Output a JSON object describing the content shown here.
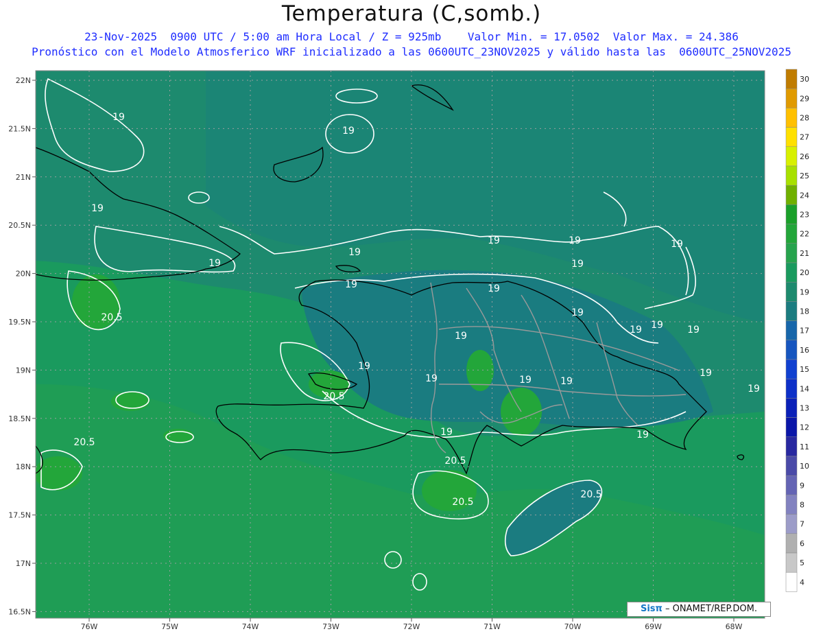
{
  "header": {
    "title": "Temperatura (C,somb.)",
    "line1": "23-Nov-2025  0900 UTC / 5:00 am Hora Local / Z = 925mb    Valor Min. = 17.0502  Valor Max. = 24.386",
    "line2": "Pronóstico con el Modelo Atmosferico WRF inicializado a las 0600UTC_23NOV2025 y válido hasta las  0600UTC_25NOV2025"
  },
  "axes": {
    "lat_labels": [
      "22N",
      "21.5N",
      "21N",
      "20.5N",
      "20N",
      "19.5N",
      "19N",
      "18.5N",
      "18N",
      "17.5N",
      "17N",
      "16.5N"
    ],
    "lon_labels": [
      "76W",
      "75W",
      "74W",
      "73W",
      "72W",
      "71W",
      "70W",
      "69W",
      "68W"
    ]
  },
  "colorbar": {
    "labels": [
      "30",
      "29",
      "28",
      "27",
      "26",
      "25",
      "24",
      "23",
      "22",
      "21",
      "20",
      "19",
      "18",
      "17",
      "16",
      "15",
      "14",
      "13",
      "12",
      "11",
      "10",
      "9",
      "8",
      "7",
      "6",
      "5",
      "4"
    ],
    "colors": [
      "#c07c00",
      "#e09a00",
      "#ffc000",
      "#ffe000",
      "#d8f000",
      "#a8e000",
      "#70b000",
      "#1aa02a",
      "#23a63a",
      "#27a34d",
      "#1a9a5e",
      "#1d8a6e",
      "#1b7c80",
      "#1766aa",
      "#1655bf",
      "#1040d0",
      "#0d30c8",
      "#0a20b8",
      "#0a16a8",
      "#2828a0",
      "#4a4aa8",
      "#6464b4",
      "#8282c0",
      "#9c9cc8",
      "#b0b0b0",
      "#c8c8c8",
      "#ffffff"
    ]
  },
  "contour_labels": [
    "19",
    "19",
    "19",
    "19",
    "19",
    "19",
    "19",
    "19",
    "19",
    "19",
    "19",
    "19",
    "19",
    "19",
    "19",
    "19",
    "19",
    "19",
    "19",
    "19",
    "19",
    "19",
    "19",
    "19",
    "20.5",
    "20.5",
    "20.5",
    "20.5",
    "20.5",
    "20.5"
  ],
  "credit": {
    "logo": "Sisπ",
    "text": "– ONAMET/REP.DOM."
  }
}
